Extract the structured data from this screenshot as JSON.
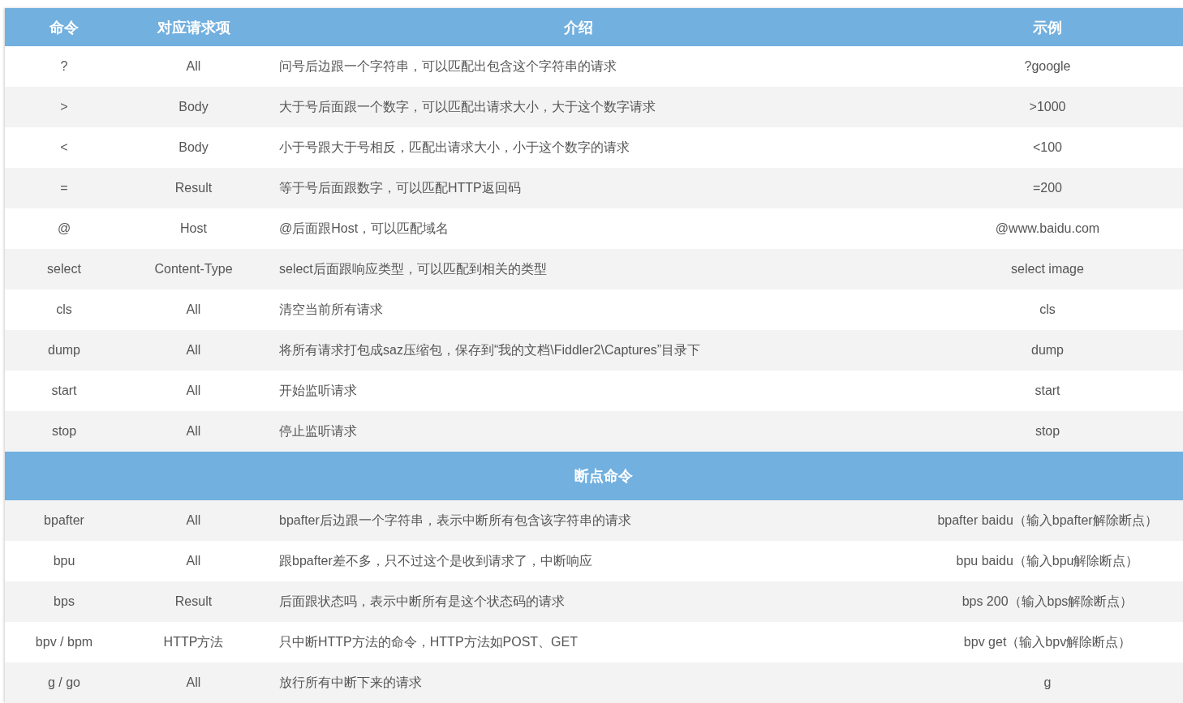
{
  "table": {
    "columns": [
      "命令",
      "对应请求项",
      "介绍",
      "示例"
    ],
    "rows": [
      [
        "?",
        "All",
        "问号后边跟一个字符串，可以匹配出包含这个字符串的请求",
        "?google"
      ],
      [
        ">",
        "Body",
        "大于号后面跟一个数字，可以匹配出请求大小，大于这个数字请求",
        ">1000"
      ],
      [
        "<",
        "Body",
        "小于号跟大于号相反，匹配出请求大小，小于这个数字的请求",
        "<100"
      ],
      [
        "=",
        "Result",
        "等于号后面跟数字，可以匹配HTTP返回码",
        "=200"
      ],
      [
        "@",
        "Host",
        "@后面跟Host，可以匹配域名",
        "@www.baidu.com"
      ],
      [
        "select",
        "Content-Type",
        "select后面跟响应类型，可以匹配到相关的类型",
        "select image"
      ],
      [
        "cls",
        "All",
        "清空当前所有请求",
        "cls"
      ],
      [
        "dump",
        "All",
        "将所有请求打包成saz压缩包，保存到“我的文档\\Fiddler2\\Captures”目录下",
        "dump"
      ],
      [
        "start",
        "All",
        "开始监听请求",
        "start"
      ],
      [
        "stop",
        "All",
        "停止监听请求",
        "stop"
      ]
    ],
    "section_title": "断点命令",
    "section_rows": [
      [
        "bpafter",
        "All",
        "bpafter后边跟一个字符串，表示中断所有包含该字符串的请求",
        "bpafter baidu（输入bpafter解除断点）"
      ],
      [
        "bpu",
        "All",
        "跟bpafter差不多，只不过这个是收到请求了，中断响应",
        "bpu baidu（输入bpu解除断点）"
      ],
      [
        "bps",
        "Result",
        "后面跟状态吗，表示中断所有是这个状态码的请求",
        "bps 200（输入bps解除断点）"
      ],
      [
        "bpv / bpm",
        "HTTP方法",
        "只中断HTTP方法的命令，HTTP方法如POST、GET",
        "bpv get（输入bpv解除断点）"
      ],
      [
        "g / go",
        "All",
        "放行所有中断下来的请求",
        "g"
      ]
    ]
  }
}
